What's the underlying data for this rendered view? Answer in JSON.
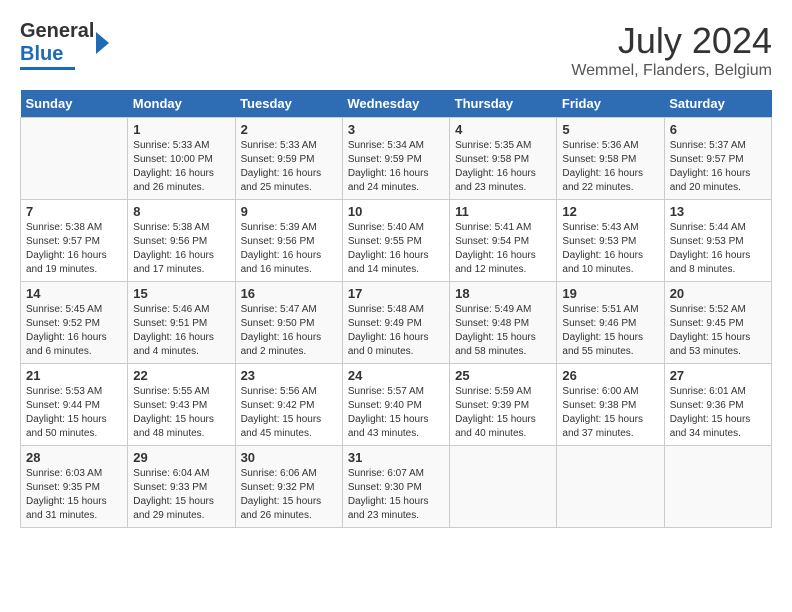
{
  "header": {
    "logo_general": "General",
    "logo_blue": "Blue",
    "title": "July 2024",
    "subtitle": "Wemmel, Flanders, Belgium"
  },
  "calendar": {
    "days_of_week": [
      "Sunday",
      "Monday",
      "Tuesday",
      "Wednesday",
      "Thursday",
      "Friday",
      "Saturday"
    ],
    "weeks": [
      [
        {
          "day": "",
          "info": ""
        },
        {
          "day": "1",
          "info": "Sunrise: 5:33 AM\nSunset: 10:00 PM\nDaylight: 16 hours\nand 26 minutes."
        },
        {
          "day": "2",
          "info": "Sunrise: 5:33 AM\nSunset: 9:59 PM\nDaylight: 16 hours\nand 25 minutes."
        },
        {
          "day": "3",
          "info": "Sunrise: 5:34 AM\nSunset: 9:59 PM\nDaylight: 16 hours\nand 24 minutes."
        },
        {
          "day": "4",
          "info": "Sunrise: 5:35 AM\nSunset: 9:58 PM\nDaylight: 16 hours\nand 23 minutes."
        },
        {
          "day": "5",
          "info": "Sunrise: 5:36 AM\nSunset: 9:58 PM\nDaylight: 16 hours\nand 22 minutes."
        },
        {
          "day": "6",
          "info": "Sunrise: 5:37 AM\nSunset: 9:57 PM\nDaylight: 16 hours\nand 20 minutes."
        }
      ],
      [
        {
          "day": "7",
          "info": "Sunrise: 5:38 AM\nSunset: 9:57 PM\nDaylight: 16 hours\nand 19 minutes."
        },
        {
          "day": "8",
          "info": "Sunrise: 5:38 AM\nSunset: 9:56 PM\nDaylight: 16 hours\nand 17 minutes."
        },
        {
          "day": "9",
          "info": "Sunrise: 5:39 AM\nSunset: 9:56 PM\nDaylight: 16 hours\nand 16 minutes."
        },
        {
          "day": "10",
          "info": "Sunrise: 5:40 AM\nSunset: 9:55 PM\nDaylight: 16 hours\nand 14 minutes."
        },
        {
          "day": "11",
          "info": "Sunrise: 5:41 AM\nSunset: 9:54 PM\nDaylight: 16 hours\nand 12 minutes."
        },
        {
          "day": "12",
          "info": "Sunrise: 5:43 AM\nSunset: 9:53 PM\nDaylight: 16 hours\nand 10 minutes."
        },
        {
          "day": "13",
          "info": "Sunrise: 5:44 AM\nSunset: 9:53 PM\nDaylight: 16 hours\nand 8 minutes."
        }
      ],
      [
        {
          "day": "14",
          "info": "Sunrise: 5:45 AM\nSunset: 9:52 PM\nDaylight: 16 hours\nand 6 minutes."
        },
        {
          "day": "15",
          "info": "Sunrise: 5:46 AM\nSunset: 9:51 PM\nDaylight: 16 hours\nand 4 minutes."
        },
        {
          "day": "16",
          "info": "Sunrise: 5:47 AM\nSunset: 9:50 PM\nDaylight: 16 hours\nand 2 minutes."
        },
        {
          "day": "17",
          "info": "Sunrise: 5:48 AM\nSunset: 9:49 PM\nDaylight: 16 hours\nand 0 minutes."
        },
        {
          "day": "18",
          "info": "Sunrise: 5:49 AM\nSunset: 9:48 PM\nDaylight: 15 hours\nand 58 minutes."
        },
        {
          "day": "19",
          "info": "Sunrise: 5:51 AM\nSunset: 9:46 PM\nDaylight: 15 hours\nand 55 minutes."
        },
        {
          "day": "20",
          "info": "Sunrise: 5:52 AM\nSunset: 9:45 PM\nDaylight: 15 hours\nand 53 minutes."
        }
      ],
      [
        {
          "day": "21",
          "info": "Sunrise: 5:53 AM\nSunset: 9:44 PM\nDaylight: 15 hours\nand 50 minutes."
        },
        {
          "day": "22",
          "info": "Sunrise: 5:55 AM\nSunset: 9:43 PM\nDaylight: 15 hours\nand 48 minutes."
        },
        {
          "day": "23",
          "info": "Sunrise: 5:56 AM\nSunset: 9:42 PM\nDaylight: 15 hours\nand 45 minutes."
        },
        {
          "day": "24",
          "info": "Sunrise: 5:57 AM\nSunset: 9:40 PM\nDaylight: 15 hours\nand 43 minutes."
        },
        {
          "day": "25",
          "info": "Sunrise: 5:59 AM\nSunset: 9:39 PM\nDaylight: 15 hours\nand 40 minutes."
        },
        {
          "day": "26",
          "info": "Sunrise: 6:00 AM\nSunset: 9:38 PM\nDaylight: 15 hours\nand 37 minutes."
        },
        {
          "day": "27",
          "info": "Sunrise: 6:01 AM\nSunset: 9:36 PM\nDaylight: 15 hours\nand 34 minutes."
        }
      ],
      [
        {
          "day": "28",
          "info": "Sunrise: 6:03 AM\nSunset: 9:35 PM\nDaylight: 15 hours\nand 31 minutes."
        },
        {
          "day": "29",
          "info": "Sunrise: 6:04 AM\nSunset: 9:33 PM\nDaylight: 15 hours\nand 29 minutes."
        },
        {
          "day": "30",
          "info": "Sunrise: 6:06 AM\nSunset: 9:32 PM\nDaylight: 15 hours\nand 26 minutes."
        },
        {
          "day": "31",
          "info": "Sunrise: 6:07 AM\nSunset: 9:30 PM\nDaylight: 15 hours\nand 23 minutes."
        },
        {
          "day": "",
          "info": ""
        },
        {
          "day": "",
          "info": ""
        },
        {
          "day": "",
          "info": ""
        }
      ]
    ]
  }
}
